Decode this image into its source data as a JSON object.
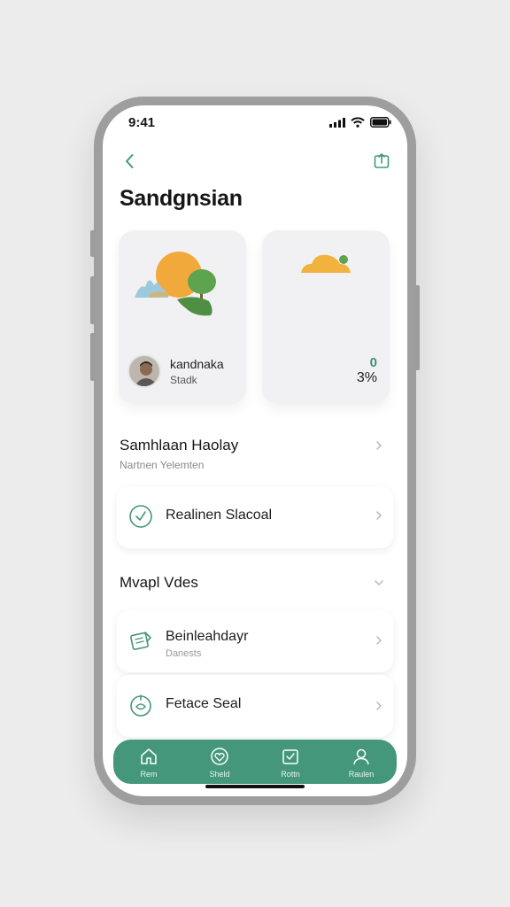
{
  "status_bar": {
    "time": "9:41"
  },
  "header": {
    "title": "Sandgnsian"
  },
  "profile_card": {
    "name": "kandnaka",
    "subtitle": "Stadk"
  },
  "stats_card": {
    "indicator": "0",
    "value": "3%"
  },
  "section_1": {
    "title": "Samhlaan Haolay",
    "subtitle": "Nartnen Yelemten"
  },
  "item_1": {
    "label": "Realinen Slacoal"
  },
  "section_2": {
    "title": "Mvapl Vdes"
  },
  "item_2": {
    "label": "Beinleahdayr",
    "subtitle": "Danests"
  },
  "item_3": {
    "label": "Fetace Seal"
  },
  "tab_bar": {
    "tabs": [
      {
        "label": "Rem",
        "icon": "home-icon"
      },
      {
        "label": "Sheld",
        "icon": "heart-icon"
      },
      {
        "label": "Rottn",
        "icon": "calendar-icon"
      },
      {
        "label": "Raulen",
        "icon": "profile-icon"
      }
    ]
  },
  "colors": {
    "accent": "#44977b",
    "accent_text": "#3e8f76",
    "sun": "#f2a93b",
    "tree": "#5ea34e",
    "water": "#9cc9dd"
  }
}
